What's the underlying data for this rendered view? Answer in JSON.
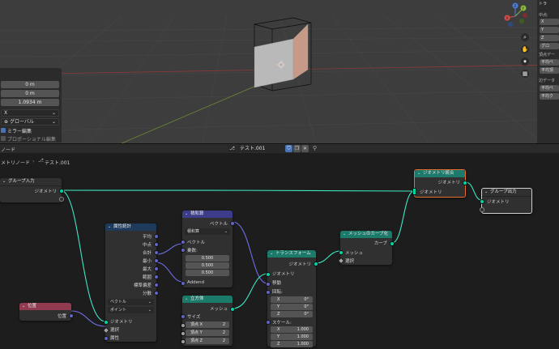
{
  "colors": {
    "viewport_bg": "#3d3d3d",
    "node_bg": "#303030",
    "geometry_socket": "#00d6a3",
    "vector_socket": "#6363c7",
    "float_socket": "#a1a1a1",
    "header_input": "#913b50",
    "header_geometry": "#1c7a6a",
    "header_utility": "#3c3c8a",
    "header_attribute": "#1e3b5e",
    "selected_node_border": "#e56d2e",
    "link": "#3ee8c4",
    "link_vector": "#6e6ee8"
  },
  "viewport": {
    "redo_panel": {
      "field_1": "0 m",
      "field_2": "0 m",
      "field_3": "1.0934 m",
      "axis_dropdown": "X",
      "orientation_dropdown": "グローバル",
      "mirror_label": "ミラー編集",
      "proportional_label": "プロポーショナル編集"
    },
    "gizmo": {
      "y": "Y",
      "x": "X",
      "z": "Z"
    },
    "npanel": {
      "header": "トラ",
      "median_label": "中点:",
      "x": "X",
      "y": "Y",
      "z": "Z",
      "btn_1": "グロ",
      "vertex_data_label": "頂点デー",
      "btn_2": "平均ベ",
      "btn_3": "平均頂",
      "edge_data_label": "辺データ",
      "btn_4": "平均ベ",
      "btn_5": "平均ク"
    }
  },
  "header": {
    "editor_label": "ノード",
    "datablock_name": "テスト.001"
  },
  "breadcrumb": {
    "root": "メトリノード",
    "current": "テスト.001"
  },
  "nodes": {
    "group_input": {
      "title": "グループ入力",
      "output": "ジオメトリ"
    },
    "attribute_statistic": {
      "title": "属性統計",
      "outputs": [
        "平均",
        "中点",
        "合計",
        "最小",
        "最大",
        "範囲",
        "標準偏差",
        "分散"
      ],
      "dropdown_type": "ベクトル",
      "dropdown_domain": "ポイント",
      "inputs": [
        "ジオメトリ",
        "選択",
        "属性"
      ]
    },
    "vector_math": {
      "title": "積和算",
      "output": "ベクトル",
      "dropdown": "積和算",
      "input_vector": "ベクトル",
      "multiplier_label": "乗数:",
      "multiplier_values": [
        "0.500",
        "0.500",
        "0.500"
      ],
      "addend": "Addend"
    },
    "cube": {
      "title": "立方体",
      "output": "メッシュ",
      "size": "サイズ",
      "vertices_x": "頂点 X",
      "vertices_x_val": "2",
      "vertices_y": "頂点 Y",
      "vertices_y_val": "2",
      "vertices_z": "頂点 Z",
      "vertices_z_val": "2"
    },
    "position": {
      "title": "位置",
      "output": "位置"
    },
    "transform": {
      "title": "トランスフォーム",
      "output": "ジオメトリ",
      "input_geometry": "ジオメトリ",
      "translation": "移動",
      "rotation": "回転:",
      "rot_x": "X",
      "rot_x_val": "0°",
      "rot_y": "Y",
      "rot_y_val": "0°",
      "rot_z": "Z",
      "rot_z_val": "0°",
      "scale": "スケール:",
      "scale_x": "X",
      "scale_x_val": "1.000",
      "scale_y": "Y",
      "scale_y_val": "1.000",
      "scale_z": "Z",
      "scale_z_val": "1.000"
    },
    "mesh_to_curve": {
      "title": "メッシュのカーブ化",
      "output": "カーブ",
      "input_mesh": "メッシュ",
      "input_selection": "選択"
    },
    "join_geometry": {
      "title": "ジオメトリ統合",
      "output": "ジオメトリ",
      "input": "ジオメトリ"
    },
    "group_output": {
      "title": "グループ出力",
      "input": "ジオメトリ"
    }
  }
}
